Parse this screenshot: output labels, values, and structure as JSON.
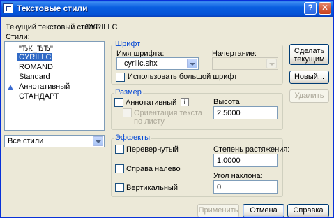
{
  "window": {
    "title": "Текстовые стили"
  },
  "current_style": {
    "label": "Текущий текстовый стиль:",
    "value": "CYRILLC"
  },
  "styles": {
    "label": "Стили:",
    "items": [
      {
        "label": "\"ЂК_ЂЂ\"",
        "selected": false
      },
      {
        "label": "CYRILLC",
        "selected": true
      },
      {
        "label": "ROMAND",
        "selected": false
      },
      {
        "label": "Standard",
        "selected": false
      },
      {
        "label": "Аннотативный",
        "selected": false,
        "icon": "annotative-icon"
      },
      {
        "label": "СТАНДАРТ",
        "selected": false
      }
    ],
    "filter": "Все стили"
  },
  "font": {
    "title": "Шрифт",
    "name_label": "Имя шрифта:",
    "name_value": "cyrillc.shx",
    "style_label": "Начертание:",
    "style_value": "",
    "big_font_label": "Использовать большой шрифт"
  },
  "size": {
    "title": "Размер",
    "annotative_label": "Аннотативный",
    "orientation_label_1": "Ориентация текста",
    "orientation_label_2": "по листу",
    "height_label": "Высота",
    "height_value": "2.5000"
  },
  "effects": {
    "title": "Эффекты",
    "upside_down_label": "Перевернутый",
    "backwards_label": "Справа налево",
    "vertical_label": "Вертикальный",
    "width_factor_label": "Степень растяжения:",
    "width_factor_value": "1.0000",
    "oblique_label": "Угол наклона:",
    "oblique_value": "0"
  },
  "buttons": {
    "set_current_1": "Сделать",
    "set_current_2": "текущим",
    "new": "Новый...",
    "delete": "Удалить",
    "apply": "Применить",
    "cancel": "Отмена",
    "help": "Справка"
  },
  "colors": {
    "titlebar": "#0a5fe0",
    "selection": "#316ac5",
    "group_title": "#0046d5"
  }
}
